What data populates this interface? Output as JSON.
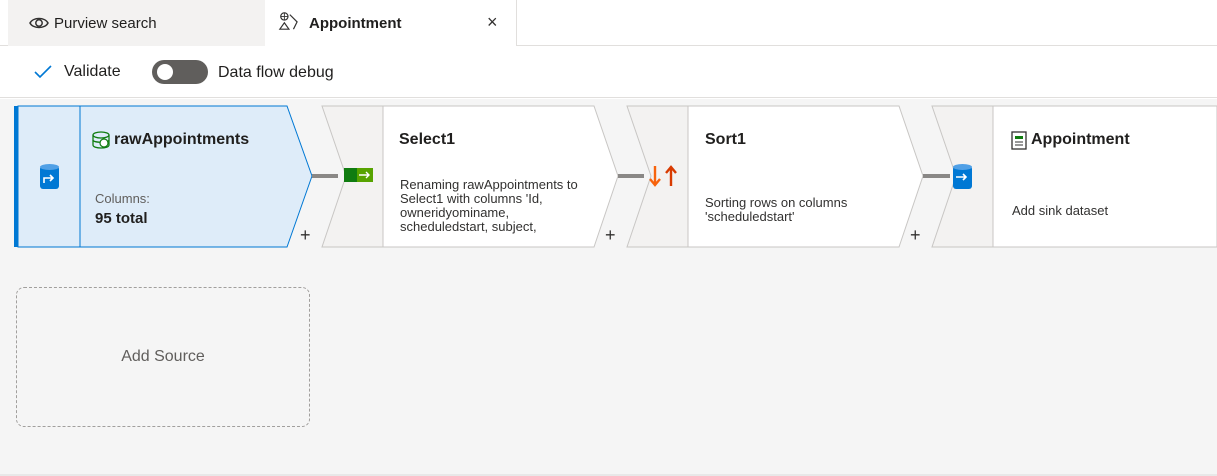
{
  "tabs": [
    {
      "label": "Purview search",
      "icon": "eye-icon"
    },
    {
      "label": "Appointment",
      "icon": "dataflow-icon",
      "close": "×"
    }
  ],
  "toolbar": {
    "validate_label": "Validate",
    "debug_label": "Data flow debug",
    "debug_on": false
  },
  "nodes": {
    "source": {
      "title": "rawAppointments",
      "columns_label": "Columns:",
      "columns_value": "95 total"
    },
    "select": {
      "title": "Select1",
      "desc_lines": [
        "Renaming rawAppointments to",
        "Select1 with columns 'Id,",
        "owneridyominame,",
        "scheduledstart, subject,"
      ]
    },
    "sort": {
      "title": "Sort1",
      "desc_lines": [
        "Sorting rows on columns",
        "'scheduledstart'"
      ]
    },
    "sink": {
      "title": "Appointment",
      "desc": "Add sink dataset"
    }
  },
  "add_label": "+",
  "add_source_label": "Add Source",
  "colors": {
    "accent": "#0078d4",
    "selected_bg": "#deecf9",
    "connector": "#8a8886"
  }
}
